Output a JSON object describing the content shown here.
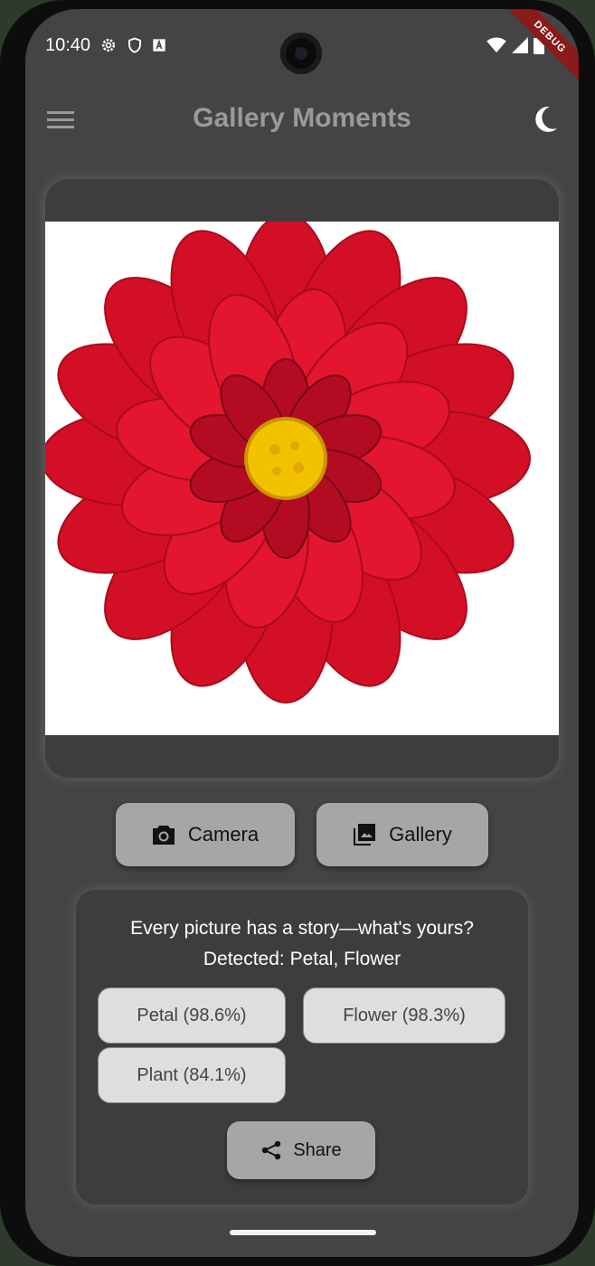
{
  "status_bar": {
    "time": "10:40",
    "left_icons": [
      "settings-icon",
      "shield-icon",
      "font-icon"
    ],
    "right_icons": [
      "wifi-icon",
      "signal-icon",
      "battery-icon"
    ],
    "debug_label": "DEBUG"
  },
  "app_bar": {
    "title": "Gallery Moments",
    "menu_icon": "menu-icon",
    "theme_icon": "moon-icon"
  },
  "image_card": {
    "image": "red-dahlia-flower"
  },
  "actions": {
    "camera_label": "Camera",
    "gallery_label": "Gallery"
  },
  "results": {
    "story": "Every picture has a story—what's yours?",
    "detected": "Detected: Petal, Flower",
    "labels": [
      {
        "text": "Petal (98.6%)"
      },
      {
        "text": "Flower (98.3%)"
      },
      {
        "text": "Plant (84.1%)"
      }
    ],
    "share_label": "Share"
  },
  "colors": {
    "background": "#444444",
    "card": "#3d3d3d",
    "button": "#a6a6a6",
    "chip": "#dedede",
    "flower_red": "#d9102a",
    "flower_center": "#f2c200"
  }
}
